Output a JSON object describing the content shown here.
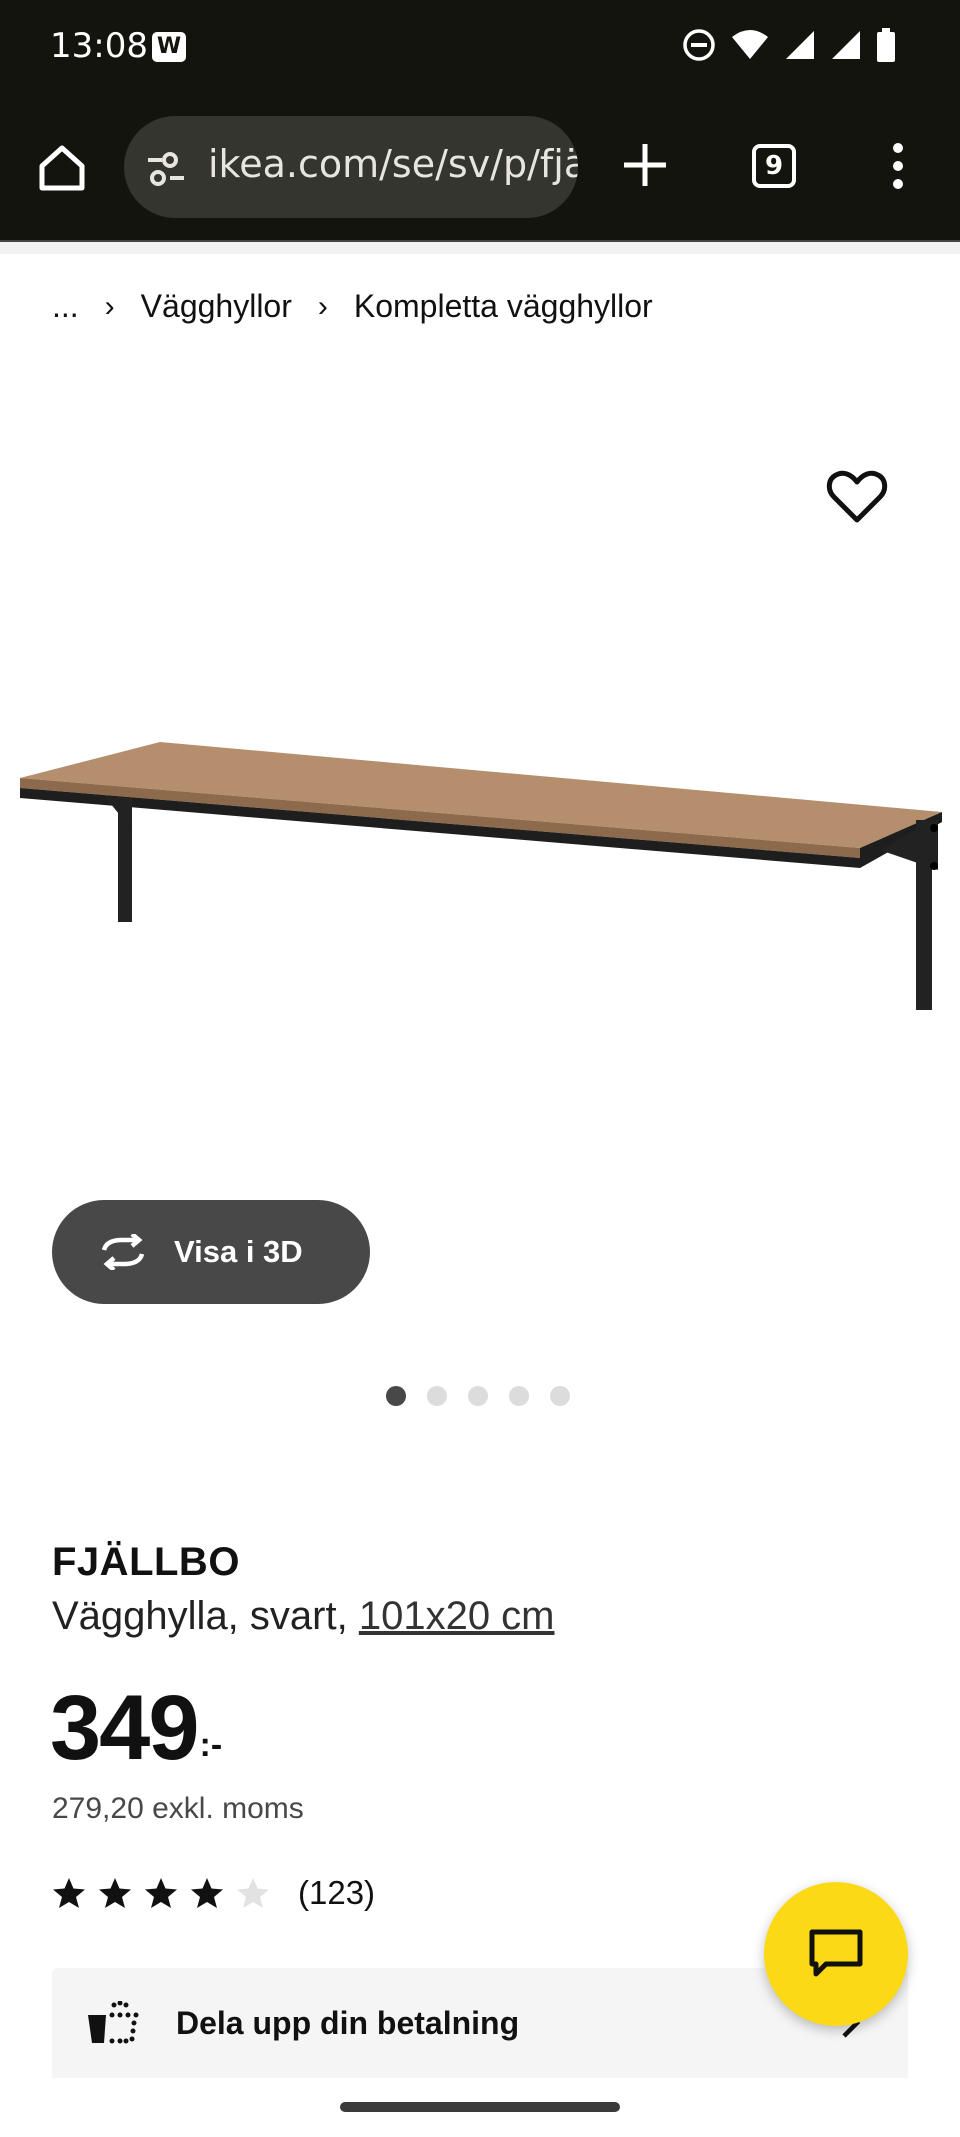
{
  "status_bar": {
    "time": "13:08",
    "app_badge": "W",
    "icons": [
      "do-not-disturb-icon",
      "wifi-icon",
      "signal-icon",
      "signal-icon",
      "battery-icon"
    ]
  },
  "browser": {
    "url": "ikea.com/se/sv/p/fjällbo",
    "tab_count": "9",
    "colors": {
      "chrome_bg": "#14140f",
      "url_bg": "#34352e"
    }
  },
  "breadcrumb": {
    "items": [
      "...",
      "Vägghyllor",
      "Kompletta vägghyllor"
    ]
  },
  "gallery": {
    "view_3d_label": "Visa i 3D",
    "dot_count": 5,
    "active_index": 0
  },
  "product": {
    "brand": "FJÄLLBO",
    "description": "Vägghylla, svart, ",
    "dimensions": "101x20 cm",
    "price_integer": "349",
    "price_suffix": ":-",
    "price_ex_vat": "279,20 exkl. moms",
    "rating_value": 4,
    "rating_max": 5,
    "review_count": "(123)"
  },
  "payment": {
    "label": "Dela upp din betalning"
  },
  "colors": {
    "fab_yellow": "#fbd914",
    "button_dark": "#484848"
  }
}
